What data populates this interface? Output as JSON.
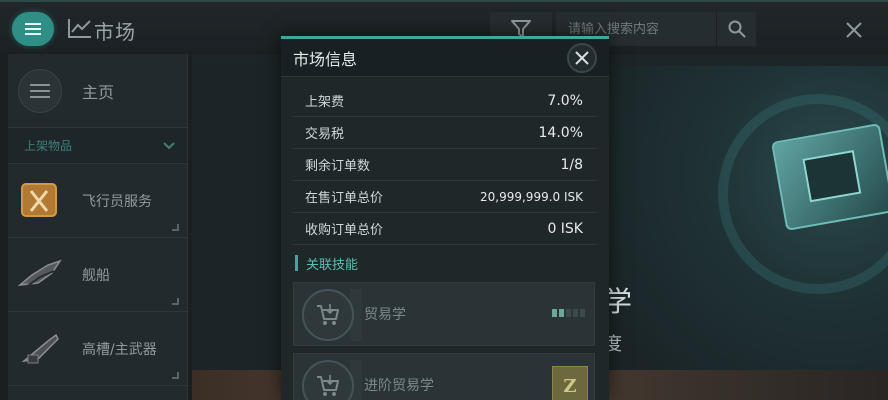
{
  "topbar": {
    "title": "市场",
    "search_placeholder": "请输入搜索内容",
    "icons": {
      "menu": "menu-icon",
      "market": "trend-chart-icon",
      "filter": "filter-icon",
      "search": "search-icon",
      "close": "close-icon"
    }
  },
  "sidebar": {
    "home_label": "主页",
    "section_label": "上架物品",
    "items": [
      {
        "label": "飞行员服务"
      },
      {
        "label": "舰船"
      },
      {
        "label": "高槽/主武器"
      }
    ]
  },
  "banner": {
    "line1": "学",
    "line2": "度"
  },
  "modal": {
    "title": "市场信息",
    "rows": [
      {
        "key": "上架费",
        "value": "7.0%"
      },
      {
        "key": "交易税",
        "value": "14.0%"
      },
      {
        "key": "剩余订单数",
        "value": "1/8"
      },
      {
        "key": "在售订单总价",
        "value": "20,999,999.0 ISK"
      },
      {
        "key": "收购订单总价",
        "value": "0 ISK"
      }
    ],
    "skills_title": "关联技能",
    "skills": [
      {
        "name": "贸易学",
        "level": 2,
        "max_level": 5
      },
      {
        "name": "进阶贸易学",
        "badge": "Z"
      }
    ]
  },
  "colors": {
    "accent": "#3fa89c",
    "menu_button": "#2f8f86",
    "badge": "#6c6a3c"
  }
}
